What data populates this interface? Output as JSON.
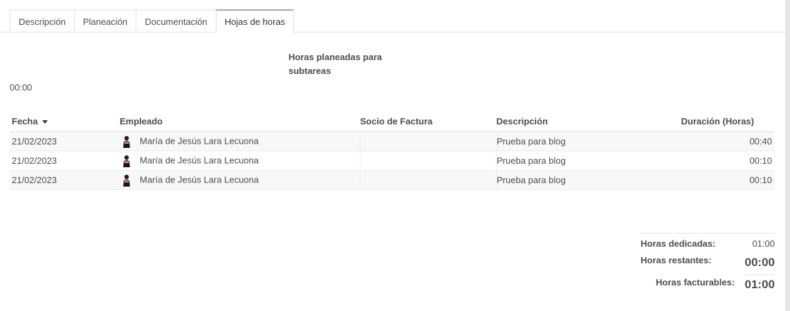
{
  "tabs": [
    "Descripción",
    "Planeación",
    "Documentación",
    "Hojas de horas"
  ],
  "planned": {
    "label": "Horas planeadas para subtareas",
    "value": "00:00"
  },
  "table": {
    "headers": {
      "date": "Fecha",
      "employee": "Empleado",
      "partner": "Socio de Factura",
      "description": "Descripción",
      "duration": "Duración (Horas)"
    },
    "rows": [
      {
        "date": "21/02/2023",
        "employee": "María de Jesús Lara Lecuona",
        "partner": "",
        "description": "Prueba para blog",
        "duration": "00:40"
      },
      {
        "date": "21/02/2023",
        "employee": "María de Jesús Lara Lecuona",
        "partner": "",
        "description": "Prueba para blog",
        "duration": "00:10"
      },
      {
        "date": "21/02/2023",
        "employee": "María de Jesús Lara Lecuona",
        "partner": "",
        "description": "Prueba para blog",
        "duration": "00:10"
      }
    ]
  },
  "totals": {
    "dedicated_label": "Horas dedicadas:",
    "dedicated_value": "01:00",
    "remaining_label": "Horas restantes:",
    "remaining_value": "00:00",
    "billable_label": "Horas facturables:",
    "billable_value": "01:00"
  },
  "colors": {
    "active_tab_accent": "#714b67"
  },
  "icons": {
    "sort": "caret-down-icon",
    "avatar": "employee-avatar"
  }
}
